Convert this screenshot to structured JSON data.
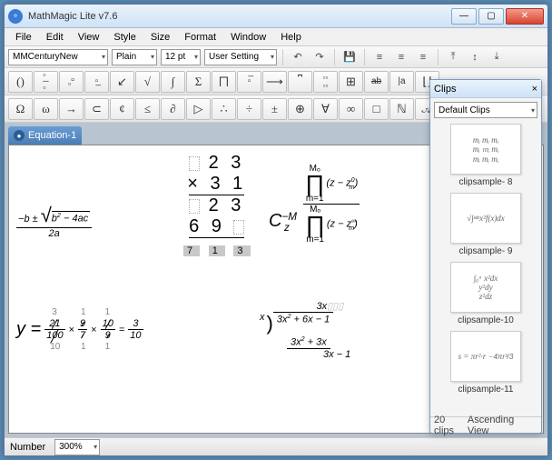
{
  "app": {
    "title": "MathMagic Lite v7.6"
  },
  "menu": [
    "File",
    "Edit",
    "View",
    "Style",
    "Size",
    "Format",
    "Window",
    "Help"
  ],
  "toolbar1": {
    "font": "MMCenturyNew",
    "variant": "Plain",
    "size": "12 pt",
    "preset": "User Setting"
  },
  "palette_row1": [
    "()",
    "⧠/⧠",
    "□□",
    "□̲",
    "↙",
    "√",
    "∫",
    "Σ",
    "⨅",
    "□̅",
    "⟶",
    "⎴",
    "□□□",
    "⊞",
    "ab",
    "|a",
    "⌊⌋"
  ],
  "palette_row2": [
    "Ω",
    "ω",
    "→",
    "⊂",
    "¢",
    "≤",
    "∂",
    "▷",
    "∴",
    "÷",
    "±",
    "⊕",
    "∀",
    "∞",
    "□",
    "ℕ",
    "𝒜",
    "ℜ"
  ],
  "document": {
    "tab": "Equation-1"
  },
  "equations": {
    "quadratic": {
      "num": "−b ± √(b² − 4ac)",
      "den": "2a"
    },
    "longdiv1": {
      "rows": [
        "  2 3",
        "× 3 1",
        "  2 3",
        "6 9  "
      ],
      "result": [
        "7",
        "1",
        "3"
      ]
    },
    "coef": "C",
    "coef_sup": "−M",
    "coef_sub": "z",
    "prod_top": {
      "op": "∏",
      "upper": "Mₒ",
      "lower": "m=1",
      "term": "(z − zₘ⁰)"
    },
    "prod_bot": {
      "op": "∏",
      "upper": "Mₒ",
      "lower": "m=1",
      "term": "(z − zₘ∞)"
    },
    "ybox": {
      "lhs": "y =",
      "f1": {
        "num": "21",
        "den": "100",
        "anum": "3",
        "aden": "10"
      },
      "f2": {
        "num": "9",
        "den": "7",
        "anum": "1",
        "aden": "1"
      },
      "f3": {
        "num": "10",
        "den": "9",
        "anum": "1",
        "aden": "1"
      },
      "eq": "= 3/10"
    },
    "polylong": {
      "quotient": "3x",
      "divisor": "x",
      "dividend": "3x² + 6x − 1",
      "step1": "3x² + 3x",
      "step2": "3x − 1"
    }
  },
  "clips": {
    "title": "Clips",
    "set": "Default Clips",
    "items": [
      {
        "label": "clipsample- 8",
        "preview": "mᵢ  mᵢ  mᵢ\\nmᵢ  mᵢ  mᵢ"
      },
      {
        "label": "clipsample- 9",
        "preview": "√∫ₐᵇ x²f(x)dx"
      },
      {
        "label": "clipsample-10",
        "preview": "∫₀ᵃ x²dx\\n y²dy\\n z²dz"
      },
      {
        "label": "clipsample-11",
        "preview": "s = πr²·r − 4πr³/3"
      }
    ],
    "count": "20 clips",
    "sort": "Ascending View"
  },
  "status": {
    "mode": "Number",
    "zoom": "300%"
  }
}
